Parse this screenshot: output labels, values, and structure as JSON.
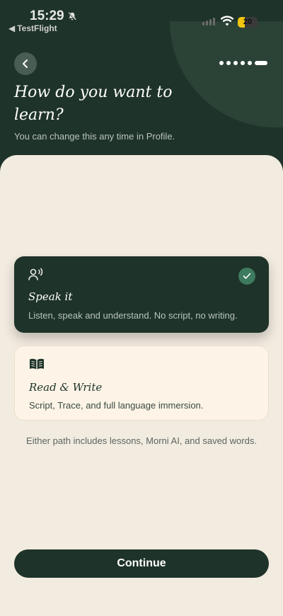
{
  "status_bar": {
    "time": "15:29",
    "back_app": "TestFlight",
    "battery": "20"
  },
  "header": {
    "title": "How do you want to learn?",
    "subtitle": "You can change this any time in Profile.",
    "progress": {
      "total_steps": 6,
      "current_step": 6
    }
  },
  "options": [
    {
      "title": "Speak it",
      "description": "Listen, speak and understand. No script, no writing.",
      "icon": "speaking-person-icon",
      "selected": true
    },
    {
      "title": "Read & Write",
      "description": "Script, Trace, and full language immersion.",
      "icon": "open-book-icon",
      "selected": false
    }
  ],
  "footnote": "Either path includes lessons, Morni AI, and saved words.",
  "continue_label": "Continue",
  "colors": {
    "brand_dark": "#1e3329",
    "background": "#f2ebe0",
    "check_green": "#3d7a5e",
    "card_light": "#fdf4e7"
  }
}
